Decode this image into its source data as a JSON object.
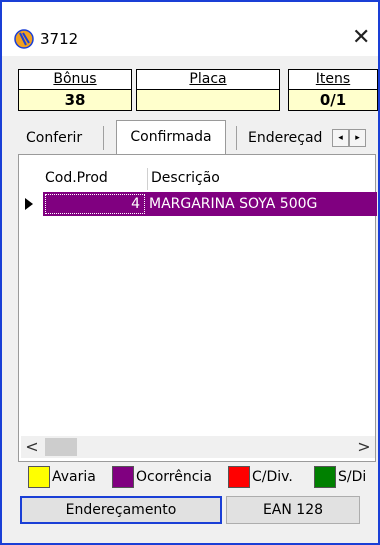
{
  "window": {
    "title": "3712",
    "close_glyph": "✕",
    "app_icon": "app-logo-icon"
  },
  "info": {
    "bonus": {
      "label": "Bônus",
      "value": "38"
    },
    "placa": {
      "label": "Placa",
      "value": ""
    },
    "itens": {
      "label": "Itens",
      "value": "0/1"
    }
  },
  "tabs": [
    {
      "label": "Conferir",
      "selected": false
    },
    {
      "label": "Confirmada",
      "selected": true
    },
    {
      "label": "Endereçad",
      "selected": false
    }
  ],
  "tab_scroll": {
    "left": "◂",
    "right": "▸"
  },
  "grid": {
    "columns": [
      "Cod.Prod",
      "Descrição"
    ],
    "rows": [
      {
        "cod": "4",
        "descricao": "MARGARINA SOYA 500G"
      }
    ],
    "selected_row_color": "#800080",
    "scroll": {
      "left": "<",
      "right": ">"
    }
  },
  "legend": [
    {
      "label": "Avaria",
      "color": "#ffff00"
    },
    {
      "label": "Ocorrência",
      "color": "#800080"
    },
    {
      "label": "C/Div.",
      "color": "#ff0000"
    },
    {
      "label": "S/Di",
      "color": "#008000"
    }
  ],
  "buttons": {
    "enderecamento": "Endereçamento",
    "ean": "EAN 128"
  }
}
